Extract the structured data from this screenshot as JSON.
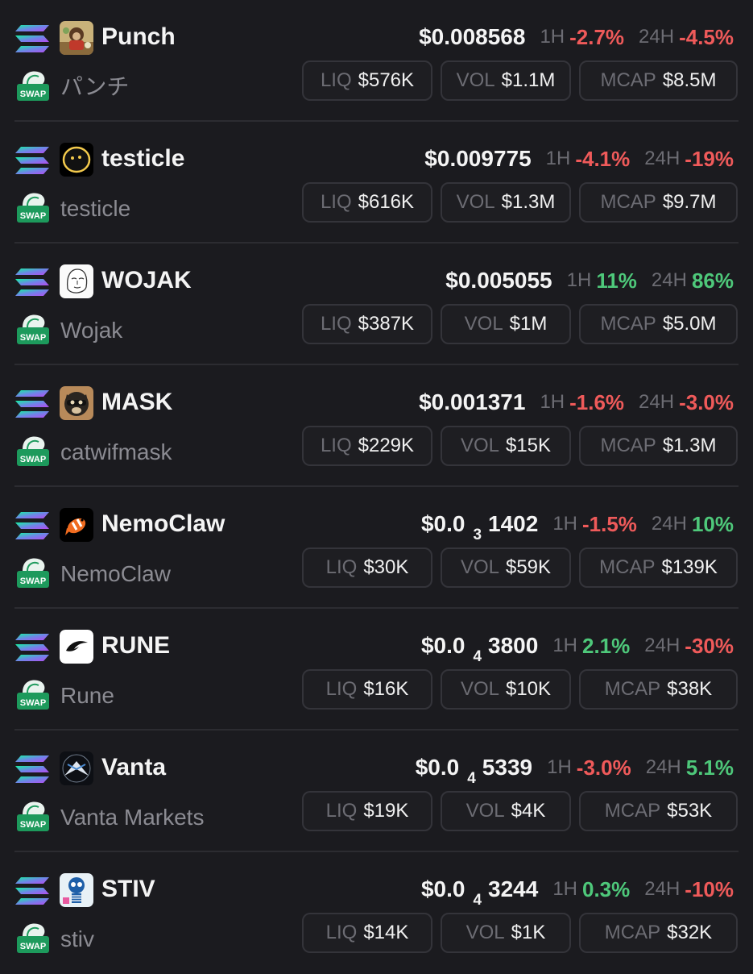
{
  "colors": {
    "background": "#1b1b1f",
    "negative": "#ef5a5a",
    "positive": "#4ec87a",
    "muted": "#8b8b92"
  },
  "labels": {
    "h1": "1H",
    "h24": "24H",
    "liq": "LIQ",
    "vol": "VOL",
    "mcap": "MCAP",
    "swap": "SWAP"
  },
  "tokens": [
    {
      "symbol": "Punch",
      "name": "パンチ",
      "price_main": "$0.008568",
      "price_zeros": "",
      "price_tail": "",
      "change_1h": "-2.7%",
      "change_1h_dir": "neg",
      "change_24h": "-4.5%",
      "change_24h_dir": "neg",
      "liq": "$576K",
      "vol": "$1.1M",
      "mcap": "$8.5M",
      "avatar_icon": "monkey-photo-avatar"
    },
    {
      "symbol": "testicle",
      "name": "testicle",
      "price_main": "$0.009775",
      "price_zeros": "",
      "price_tail": "",
      "change_1h": "-4.1%",
      "change_1h_dir": "neg",
      "change_24h": "-19%",
      "change_24h_dir": "neg",
      "liq": "$616K",
      "vol": "$1.3M",
      "mcap": "$9.7M",
      "avatar_icon": "face-avatar"
    },
    {
      "symbol": "WOJAK",
      "name": "Wojak",
      "price_main": "$0.005055",
      "price_zeros": "",
      "price_tail": "",
      "change_1h": "11%",
      "change_1h_dir": "pos",
      "change_24h": "86%",
      "change_24h_dir": "pos",
      "liq": "$387K",
      "vol": "$1M",
      "mcap": "$5.0M",
      "avatar_icon": "wojak-avatar"
    },
    {
      "symbol": "MASK",
      "name": "catwifmask",
      "price_main": "$0.001371",
      "price_zeros": "",
      "price_tail": "",
      "change_1h": "-1.6%",
      "change_1h_dir": "neg",
      "change_24h": "-3.0%",
      "change_24h_dir": "neg",
      "liq": "$229K",
      "vol": "$15K",
      "mcap": "$1.3M",
      "avatar_icon": "masked-cat-avatar"
    },
    {
      "symbol": "NemoClaw",
      "name": "NemoClaw",
      "price_main": "$0.0",
      "price_zeros": "3",
      "price_tail": "1402",
      "change_1h": "-1.5%",
      "change_1h_dir": "neg",
      "change_24h": "10%",
      "change_24h_dir": "pos",
      "liq": "$30K",
      "vol": "$59K",
      "mcap": "$139K",
      "avatar_icon": "clownfish-avatar"
    },
    {
      "symbol": "RUNE",
      "name": "Rune",
      "price_main": "$0.0",
      "price_zeros": "4",
      "price_tail": "3800",
      "change_1h": "2.1%",
      "change_1h_dir": "pos",
      "change_24h": "-30%",
      "change_24h_dir": "neg",
      "liq": "$16K",
      "vol": "$10K",
      "mcap": "$38K",
      "avatar_icon": "rune-logo-avatar"
    },
    {
      "symbol": "Vanta",
      "name": "Vanta Markets",
      "price_main": "$0.0",
      "price_zeros": "4",
      "price_tail": "5339",
      "change_1h": "-3.0%",
      "change_1h_dir": "neg",
      "change_24h": "5.1%",
      "change_24h_dir": "pos",
      "liq": "$19K",
      "vol": "$4K",
      "mcap": "$53K",
      "avatar_icon": "vanta-logo-avatar"
    },
    {
      "symbol": "STIV",
      "name": "stiv",
      "price_main": "$0.0",
      "price_zeros": "4",
      "price_tail": "3244",
      "change_1h": "0.3%",
      "change_1h_dir": "pos",
      "change_24h": "-10%",
      "change_24h_dir": "neg",
      "liq": "$14K",
      "vol": "$1K",
      "mcap": "$32K",
      "avatar_icon": "skeleton-avatar"
    }
  ]
}
